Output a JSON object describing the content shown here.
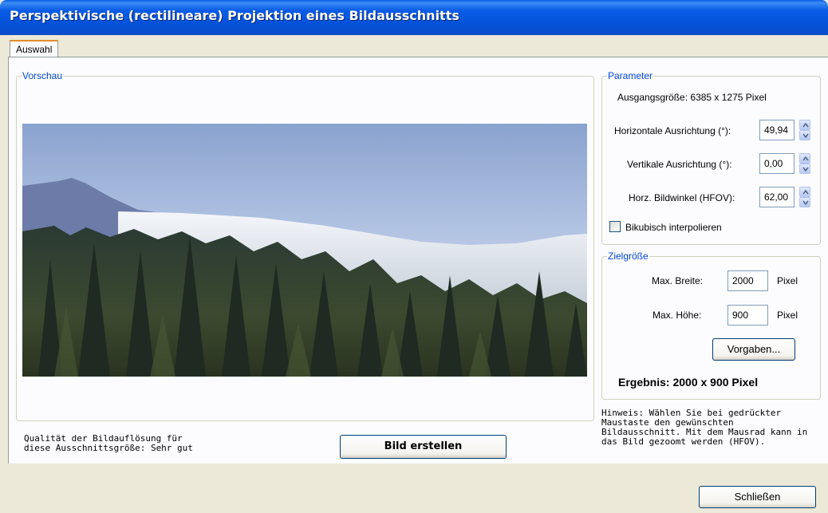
{
  "window": {
    "title": "Perspektivische (rectilineare) Projektion eines Bildausschnitts"
  },
  "tabs": [
    {
      "label": "Auswahl"
    }
  ],
  "preview": {
    "legend": "Vorschau"
  },
  "parameter": {
    "legend": "Parameter",
    "source_size": "Ausgangsgröße: 6385 x 1275 Pixel",
    "horizontal_label": "Horizontale Ausrichtung (°):",
    "horizontal_value": "49,94",
    "vertical_label": "Vertikale Ausrichtung (°):",
    "vertical_value": "0,00",
    "hfov_label": "Horz. Bildwinkel (HFOV):",
    "hfov_value": "62,00",
    "bicubic_label": "Bikubisch interpolieren",
    "bicubic_checked": false
  },
  "target": {
    "legend": "Zielgröße",
    "max_width_label": "Max. Breite:",
    "max_width_value": "2000",
    "max_width_unit": "Pixel",
    "max_height_label": "Max. Höhe:",
    "max_height_value": "900",
    "max_height_unit": "Pixel",
    "defaults_button": "Vorgaben...",
    "result": "Ergebnis: 2000 x 900 Pixel"
  },
  "hint": "Hinweis: Wählen Sie bei gedrückter Maustaste den gewünschten Bildausschnitt. Mit dem Mausrad kann in das Bild gezoomt werden (HFOV).",
  "hint_lines": [
    "Hinweis: Wählen Sie bei gedrückter",
    "Maustaste den gewünschten",
    "Bildausschnitt. Mit dem Mausrad kann in",
    "das Bild gezoomt werden (HFOV)."
  ],
  "quality_lines": [
    "Qualität der Bildauflösung für",
    "diese Ausschnittsgröße: Sehr gut"
  ],
  "create_button": "Bild erstellen",
  "close_button": "Schließen",
  "colors": {
    "title_bar": "#0a5ce6",
    "accent_tab": "#e68b2c",
    "legend": "#0046d5",
    "face": "#ece9d8"
  }
}
